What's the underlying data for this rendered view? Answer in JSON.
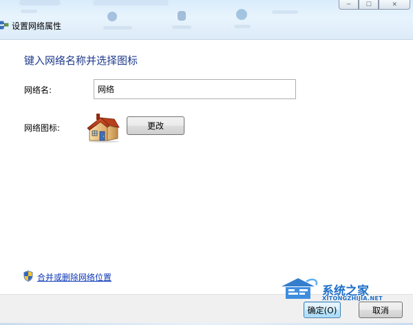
{
  "window": {
    "title": "设置网络属性",
    "controls": {
      "minimize": "─",
      "maximize": "☐",
      "close": "✕"
    }
  },
  "main": {
    "instruction": "键入网络名称并选择图标",
    "name_label": "网络名:",
    "name_value": "网络",
    "icon_label": "网络图标:",
    "icon": "house-icon",
    "change_button": "更改",
    "link_text": "合并或删除网络位置"
  },
  "footer": {
    "ok_button": "确定(O)",
    "cancel_button": "取消"
  },
  "watermark": {
    "main": "系统之家",
    "sub": "XITONGZHIJIA.NET"
  },
  "colors": {
    "instruction": "#1e3a8a",
    "link": "#0a36b8",
    "watermark": "#1f6fc8"
  }
}
